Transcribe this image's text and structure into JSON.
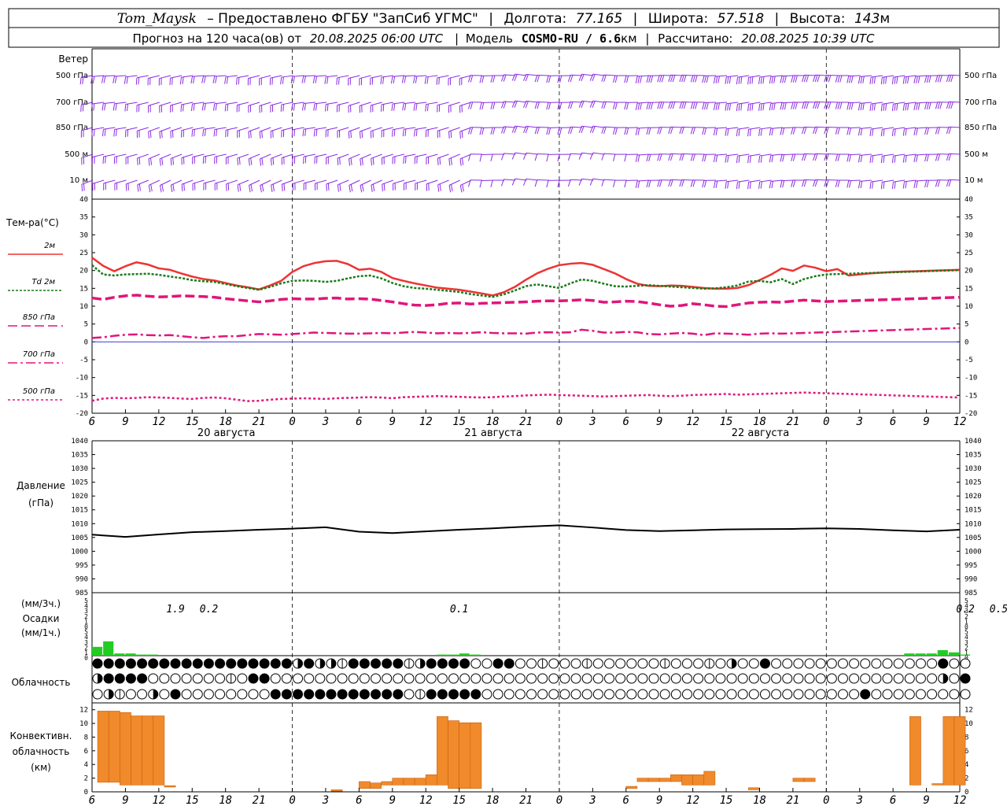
{
  "header": {
    "station": "Tom_Maysk",
    "provided_by": "– Предоставлено ФГБУ \"ЗапСиб УГМС\"",
    "lon_label": "Долгота:",
    "lon_value": "77.165",
    "lat_label": "Широта:",
    "lat_value": "57.518",
    "alt_label": "Высота:",
    "alt_value": "143",
    "alt_unit": "м",
    "forecast_label": "Прогноз на 120 часа(ов) от",
    "forecast_time": "20.08.2025 06:00 UTC",
    "model_label": "Модель",
    "model_name": "COSMO-RU / 6.6",
    "model_unit": "км",
    "computed_label": "Рассчитано:",
    "computed_time": "20.08.2025 10:39 UTC"
  },
  "panels": {
    "wind": {
      "title": "Ветер",
      "levels": [
        "500 гПа",
        "700 гПа",
        "850 гПа",
        "500  м",
        "10  м"
      ],
      "color": "#8a2be2"
    },
    "temperature": {
      "title": "Тем-ра(°C)",
      "legend": [
        {
          "name": "2м",
          "color": "#ee3333",
          "style": "solid"
        },
        {
          "name": "Td  2м",
          "color": "#1a7a1a",
          "style": "dotted"
        },
        {
          "name": "850 гПа",
          "color": "#e0167a",
          "style": "dash"
        },
        {
          "name": "700 гПа",
          "color": "#e0167a",
          "style": "dashdot"
        },
        {
          "name": "500 гПа",
          "color": "#e0167a",
          "style": "dot"
        }
      ],
      "ylim": [
        -20,
        40
      ],
      "yticks": [
        "40",
        "35",
        "30",
        "25",
        "20",
        "15",
        "10",
        "5",
        "0",
        "-5",
        "-10",
        "-15",
        "-20"
      ]
    },
    "pressure": {
      "title": "Давление",
      "unit": "(гПа)",
      "ylim": [
        985,
        1040
      ],
      "yticks": [
        "1040",
        "1035",
        "1030",
        "1025",
        "1020",
        "1015",
        "1010",
        "1005",
        "1000",
        "995",
        "990",
        "985"
      ]
    },
    "precip": {
      "unit3": "(мм/3ч.)",
      "title": "Осадки",
      "unit1": "(мм/1ч.)",
      "yticks": [
        "5",
        "4",
        "3",
        "2",
        "1",
        "0",
        "5",
        "4",
        "3",
        "2",
        "1",
        "0"
      ],
      "labels": [
        {
          "text": "1.9",
          "hour": 7.5
        },
        {
          "text": "0.2",
          "hour": 10.5
        },
        {
          "text": "0.1",
          "hour": 33
        },
        {
          "text": "0.2",
          "hour": 78.5
        },
        {
          "text": "0.5",
          "hour": 81.5
        }
      ]
    },
    "cloud": {
      "title": "Облачность"
    },
    "convective": {
      "title_lines": [
        "Конвективн.",
        "облачность",
        "(км)"
      ],
      "ylim": [
        0,
        13
      ],
      "yticks": [
        "12",
        "10",
        "8",
        "6",
        "4",
        "2",
        "0"
      ]
    }
  },
  "axis": {
    "hour_labels": [
      "6",
      "9",
      "12",
      "15",
      "18",
      "21",
      "0",
      "3",
      "6",
      "9",
      "12",
      "15",
      "18",
      "21",
      "0",
      "3",
      "6",
      "9",
      "12",
      "15",
      "18",
      "21",
      "0",
      "3",
      "6",
      "9",
      "12"
    ],
    "day_labels": [
      {
        "text": "20 августа",
        "hour": 12
      },
      {
        "text": "21 августа",
        "hour": 36
      },
      {
        "text": "22 августа",
        "hour": 60
      }
    ],
    "midnights": [
      18,
      42,
      66
    ]
  },
  "chart_data": [
    {
      "type": "line",
      "name": "temperature",
      "x_hours": [
        0,
        1,
        2,
        3,
        4,
        5,
        6,
        7,
        8,
        9,
        10,
        11,
        12,
        13,
        14,
        15,
        16,
        17,
        18,
        19,
        20,
        21,
        22,
        23,
        24,
        25,
        26,
        27,
        28,
        29,
        30,
        31,
        32,
        33,
        34,
        35,
        36,
        37,
        38,
        39,
        40,
        41,
        42,
        43,
        44,
        45,
        46,
        47,
        48,
        49,
        50,
        51,
        52,
        53,
        54,
        55,
        56,
        57,
        58,
        59,
        60,
        61,
        62,
        63,
        64,
        65,
        66,
        67,
        68,
        69,
        70,
        71,
        72,
        73,
        74,
        75,
        76,
        77,
        78
      ],
      "series": [
        {
          "name": "2м",
          "values": [
            23.6,
            21.3,
            19.8,
            21.2,
            22.3,
            21.7,
            20.6,
            20.2,
            19.2,
            18.3,
            17.6,
            17.2,
            16.5,
            15.8,
            15.3,
            14.7,
            15.8,
            17.1,
            19.6,
            21.2,
            22.1,
            22.6,
            22.7,
            21.8,
            20.2,
            20.5,
            19.6,
            17.9,
            17.1,
            16.4,
            15.8,
            15.2,
            14.9,
            14.6,
            14.1,
            13.6,
            13.0,
            13.9,
            15.4,
            17.4,
            19.2,
            20.5,
            21.5,
            21.9,
            22.1,
            21.6,
            20.4,
            19.2,
            17.6,
            16.3,
            15.7,
            15.6,
            15.8,
            15.7,
            15.4,
            15.1,
            14.9,
            14.9,
            15.1,
            15.9,
            17.3,
            18.8,
            20.6,
            19.9,
            21.4,
            20.8,
            19.8,
            20.4,
            18.6,
            18.9,
            19.2,
            19.4,
            19.6,
            19.7,
            19.8,
            19.9,
            20.0,
            20.1,
            20.2
          ]
        },
        {
          "name": "Td  2м",
          "values": [
            21.5,
            18.9,
            18.6,
            18.9,
            19.0,
            19.1,
            18.8,
            18.3,
            17.9,
            17.3,
            17.0,
            16.8,
            16.2,
            15.6,
            15.1,
            14.6,
            15.4,
            16.4,
            17.1,
            17.2,
            17.1,
            16.8,
            17.1,
            17.8,
            18.4,
            18.6,
            17.8,
            16.5,
            15.6,
            15.1,
            14.9,
            14.6,
            14.3,
            14.0,
            13.4,
            13.0,
            12.6,
            13.3,
            14.4,
            15.6,
            16.1,
            15.6,
            15.1,
            16.4,
            17.5,
            17.1,
            16.3,
            15.6,
            15.5,
            15.7,
            15.9,
            15.7,
            15.5,
            15.3,
            15.1,
            14.9,
            15.0,
            15.3,
            15.8,
            16.9,
            17.1,
            16.7,
            17.6,
            16.2,
            17.6,
            18.4,
            18.9,
            19.0,
            19.1,
            19.2,
            19.3,
            19.4,
            19.5,
            19.6,
            19.7,
            19.8,
            19.9,
            20.0,
            20.1
          ]
        },
        {
          "name": "850 гПа",
          "values": [
            12.3,
            11.9,
            12.5,
            12.9,
            13.1,
            12.8,
            12.6,
            12.7,
            12.9,
            12.8,
            12.7,
            12.5,
            12.1,
            11.8,
            11.5,
            11.2,
            11.5,
            11.9,
            12.1,
            12.0,
            12.0,
            12.2,
            12.3,
            12.0,
            12.1,
            12.0,
            11.6,
            11.2,
            10.7,
            10.3,
            10.2,
            10.4,
            10.8,
            10.9,
            10.6,
            10.8,
            10.9,
            11.0,
            11.1,
            11.2,
            11.4,
            11.5,
            11.5,
            11.6,
            11.8,
            11.6,
            11.1,
            11.2,
            11.4,
            11.3,
            10.9,
            10.4,
            10.0,
            10.2,
            10.7,
            10.4,
            10.0,
            9.9,
            10.4,
            10.9,
            11.1,
            11.2,
            11.1,
            11.4,
            11.7,
            11.5,
            11.3,
            11.4,
            11.5,
            11.6,
            11.7,
            11.8,
            11.9,
            12.0,
            12.1,
            12.2,
            12.3,
            12.4,
            12.5
          ]
        },
        {
          "name": "700 гПа",
          "values": [
            1.1,
            1.3,
            1.7,
            2.0,
            2.1,
            1.9,
            1.8,
            1.9,
            1.6,
            1.3,
            1.1,
            1.4,
            1.6,
            1.6,
            1.9,
            2.2,
            2.1,
            2.0,
            2.2,
            2.4,
            2.6,
            2.5,
            2.4,
            2.3,
            2.3,
            2.4,
            2.5,
            2.4,
            2.6,
            2.8,
            2.6,
            2.4,
            2.5,
            2.4,
            2.5,
            2.7,
            2.5,
            2.4,
            2.4,
            2.3,
            2.6,
            2.7,
            2.6,
            2.7,
            3.4,
            3.1,
            2.6,
            2.6,
            2.8,
            2.7,
            2.2,
            2.1,
            2.3,
            2.5,
            2.3,
            1.9,
            2.4,
            2.3,
            2.2,
            2.0,
            2.3,
            2.4,
            2.3,
            2.4,
            2.5,
            2.6,
            2.7,
            2.8,
            2.9,
            3.0,
            3.1,
            3.2,
            3.3,
            3.4,
            3.5,
            3.6,
            3.7,
            3.8,
            3.9
          ]
        },
        {
          "name": "500 гПа",
          "values": [
            -16.5,
            -15.9,
            -15.7,
            -15.8,
            -15.7,
            -15.5,
            -15.6,
            -15.7,
            -15.9,
            -16.0,
            -15.7,
            -15.6,
            -15.8,
            -16.2,
            -16.6,
            -16.5,
            -16.2,
            -16.0,
            -15.9,
            -15.8,
            -15.9,
            -16.0,
            -15.8,
            -15.7,
            -15.6,
            -15.5,
            -15.6,
            -15.8,
            -15.5,
            -15.4,
            -15.3,
            -15.2,
            -15.3,
            -15.4,
            -15.5,
            -15.6,
            -15.5,
            -15.3,
            -15.2,
            -15.0,
            -14.9,
            -14.8,
            -14.9,
            -15.0,
            -15.1,
            -15.2,
            -15.3,
            -15.2,
            -15.1,
            -15.0,
            -14.9,
            -15.1,
            -15.2,
            -15.1,
            -14.9,
            -14.8,
            -14.7,
            -14.6,
            -14.8,
            -14.7,
            -14.6,
            -14.5,
            -14.4,
            -14.3,
            -14.2,
            -14.3,
            -14.4,
            -14.5,
            -14.6,
            -14.7,
            -14.8,
            -14.9,
            -15.0,
            -15.1,
            -15.2,
            -15.3,
            -15.4,
            -15.5,
            -15.6
          ]
        }
      ]
    },
    {
      "type": "line",
      "name": "pressure",
      "x_hours": [
        0,
        3,
        6,
        9,
        12,
        15,
        18,
        21,
        24,
        27,
        30,
        33,
        36,
        39,
        42,
        45,
        48,
        51,
        54,
        57,
        60,
        63,
        66,
        69,
        72,
        75,
        78
      ],
      "series": [
        {
          "name": "Давление",
          "values": [
            1006.0,
            1005.2,
            1006.1,
            1006.9,
            1007.3,
            1007.8,
            1008.2,
            1008.7,
            1007.1,
            1006.6,
            1007.2,
            1007.8,
            1008.3,
            1008.9,
            1009.4,
            1008.6,
            1007.7,
            1007.3,
            1007.6,
            1007.9,
            1008.0,
            1008.1,
            1008.3,
            1008.1,
            1007.6,
            1007.2,
            1007.8
          ]
        }
      ]
    },
    {
      "type": "bar",
      "name": "precipitation",
      "x_hours": [
        0,
        1,
        2,
        3,
        4,
        5,
        31,
        32,
        33,
        34,
        35,
        36,
        37,
        73,
        74,
        75,
        76,
        77,
        78
      ],
      "series": [
        {
          "name": "мм/1ч.",
          "values": [
            0.8,
            1.3,
            0.2,
            0.2,
            0.1,
            0.1,
            0.1,
            0.1,
            0.2,
            0.1,
            0,
            0,
            0,
            0.2,
            0.2,
            0.2,
            0.5,
            0.3,
            0.1
          ]
        }
      ]
    },
    {
      "type": "bar",
      "name": "convective_cloud",
      "bars": [
        {
          "hour": 0.5,
          "base": 1.4,
          "top": 11.8
        },
        {
          "hour": 1.5,
          "base": 1.4,
          "top": 11.8
        },
        {
          "hour": 2.5,
          "base": 1.0,
          "top": 11.6
        },
        {
          "hour": 3.5,
          "base": 1.0,
          "top": 11.1
        },
        {
          "hour": 4.5,
          "base": 1.0,
          "top": 11.1
        },
        {
          "hour": 5.5,
          "base": 1.0,
          "top": 11.1
        },
        {
          "hour": 6.5,
          "base": 0.7,
          "top": 0.9
        },
        {
          "hour": 21.5,
          "base": 0.1,
          "top": 0.3
        },
        {
          "hour": 24,
          "base": 0.5,
          "top": 1.5
        },
        {
          "hour": 25,
          "base": 0.5,
          "top": 1.3
        },
        {
          "hour": 26,
          "base": 1.0,
          "top": 1.5
        },
        {
          "hour": 27,
          "base": 1.0,
          "top": 2.0
        },
        {
          "hour": 28,
          "base": 1.0,
          "top": 2.0
        },
        {
          "hour": 29,
          "base": 1.0,
          "top": 2.0
        },
        {
          "hour": 30,
          "base": 1.0,
          "top": 2.5
        },
        {
          "hour": 31,
          "base": 1.0,
          "top": 11.0
        },
        {
          "hour": 32,
          "base": 0.5,
          "top": 10.4
        },
        {
          "hour": 33,
          "base": 0.5,
          "top": 10.1
        },
        {
          "hour": 34,
          "base": 0.5,
          "top": 10.1
        },
        {
          "hour": 48,
          "base": 0.5,
          "top": 0.8
        },
        {
          "hour": 49,
          "base": 1.5,
          "top": 2.0
        },
        {
          "hour": 50,
          "base": 1.5,
          "top": 2.0
        },
        {
          "hour": 51,
          "base": 1.5,
          "top": 2.0
        },
        {
          "hour": 52,
          "base": 1.5,
          "top": 2.5
        },
        {
          "hour": 53,
          "base": 1.0,
          "top": 2.5
        },
        {
          "hour": 54,
          "base": 1.0,
          "top": 2.5
        },
        {
          "hour": 55,
          "base": 1.0,
          "top": 3.0
        },
        {
          "hour": 59,
          "base": 0.3,
          "top": 0.6
        },
        {
          "hour": 63,
          "base": 1.5,
          "top": 2.0
        },
        {
          "hour": 64,
          "base": 1.5,
          "top": 2.0
        },
        {
          "hour": 73.5,
          "base": 1.0,
          "top": 11.0
        },
        {
          "hour": 75.5,
          "base": 1.0,
          "top": 1.2
        },
        {
          "hour": 76.5,
          "base": 1.0,
          "top": 11.0
        },
        {
          "hour": 77.5,
          "base": 1.0,
          "top": 11.0
        }
      ]
    }
  ],
  "cloud_rows": {
    "row1": "44444444444444444434332444442344441144112111211111121112131141111111111111114111141113",
    "row2": "34444111111121441111111111111111111111111111111111111111111111111111111111113141232",
    "row3": "13211314111111114444444444441244444111111111111111111111111111111111141111111111111"
  }
}
